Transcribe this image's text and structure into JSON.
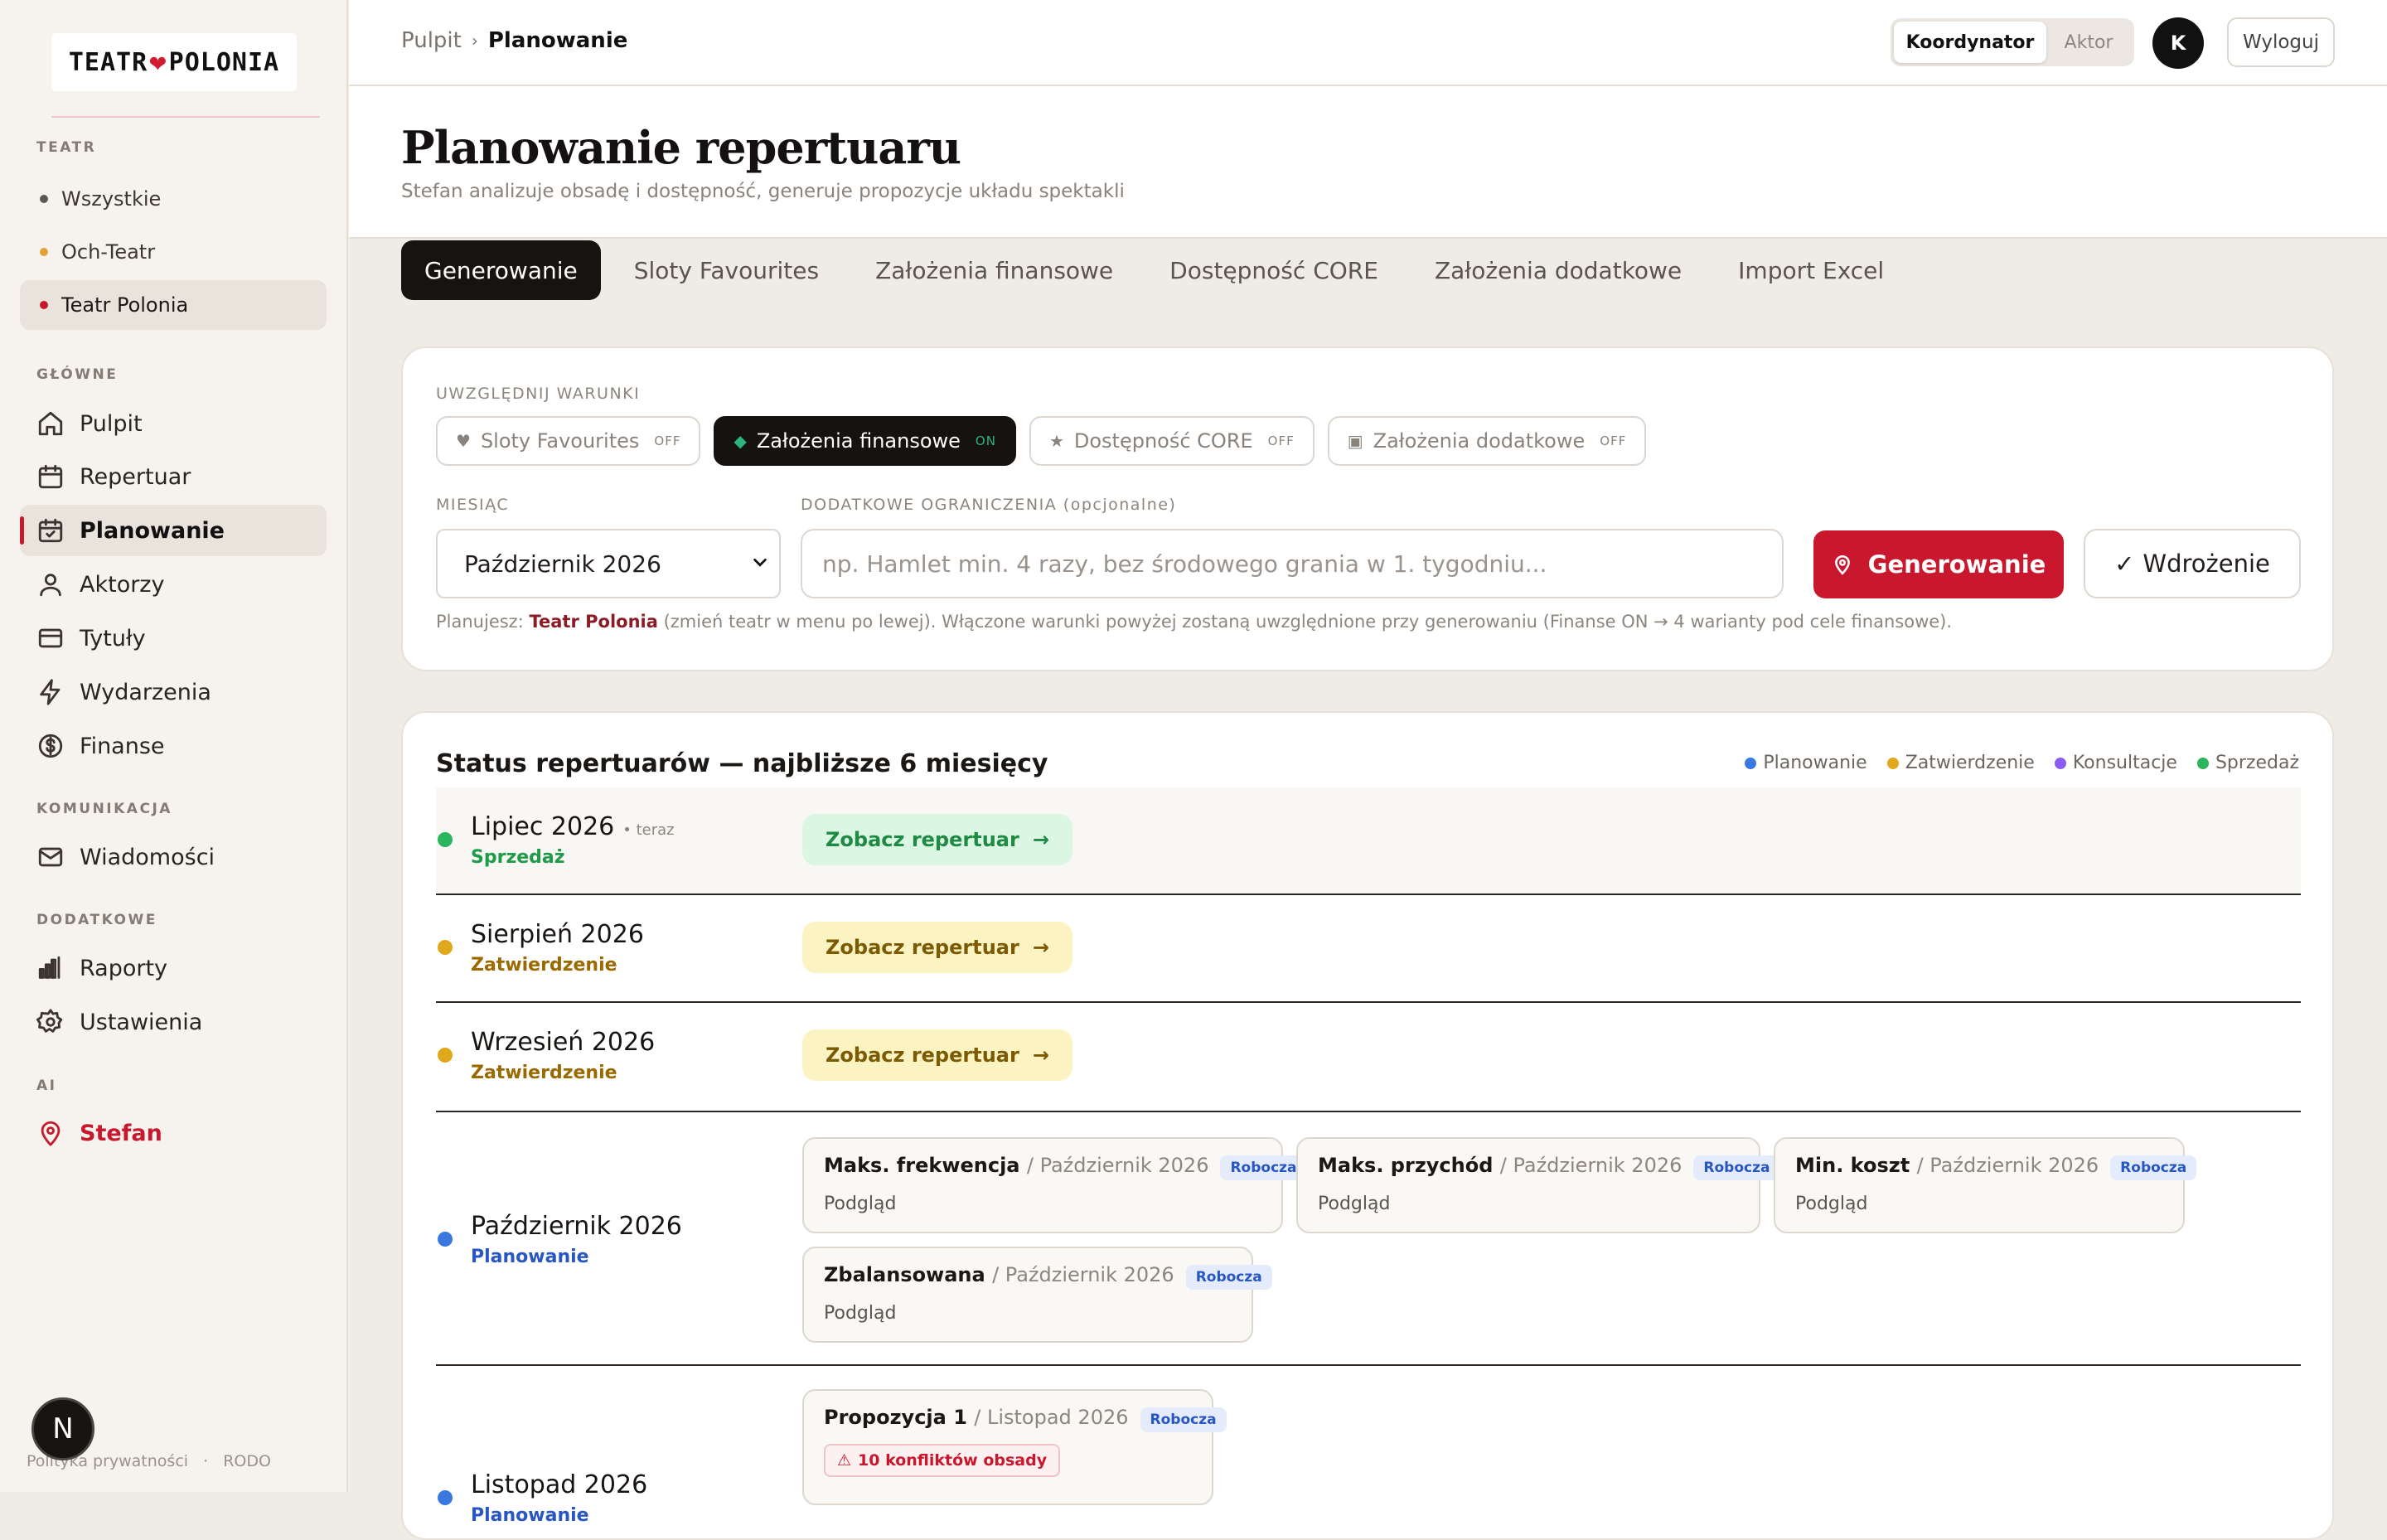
{
  "sidebar": {
    "logo_left": "TEATR",
    "logo_heart": "❤",
    "logo_right": "POLONIA",
    "sec_theatre": "TEATR",
    "theatres": [
      {
        "label": "Wszystkie",
        "color": "#5c5550"
      },
      {
        "label": "Och-Teatr",
        "color": "#e2a23a"
      },
      {
        "label": "Teatr Polonia",
        "color": "#c8182d"
      }
    ],
    "sec_main": "GŁÓWNE",
    "nav_main": [
      "Pulpit",
      "Repertuar",
      "Planowanie",
      "Aktorzy",
      "Tytuły",
      "Wydarzenia",
      "Finanse"
    ],
    "sec_comm": "KOMUNIKACJA",
    "nav_comm": [
      "Wiadomości"
    ],
    "sec_extra": "DODATKOWE",
    "nav_extra": [
      "Raporty",
      "Ustawienia"
    ],
    "sec_ai": "AI",
    "nav_ai": "Stefan",
    "footer_privacy": "Polityka prywatności",
    "footer_dot": "·",
    "footer_rodo": "RODO",
    "badge": "N"
  },
  "topbar": {
    "breadcrumb_root": "Pulpit",
    "breadcrumb_sep": "›",
    "breadcrumb_current": "Planowanie",
    "role_active": "Koordynator",
    "role_inactive": "Aktor",
    "avatar": "K",
    "logout": "Wyloguj"
  },
  "page": {
    "title": "Planowanie repertuaru",
    "subtitle": "Stefan analizuje obsadę i dostępność, generuje propozycje układu spektakli"
  },
  "tabs": [
    "Generowanie",
    "Sloty Favourites",
    "Założenia finansowe",
    "Dostępność CORE",
    "Założenia dodatkowe",
    "Import Excel"
  ],
  "generator": {
    "conditions_label": "UWZGLĘDNIJ WARUNKI",
    "chips": [
      {
        "icon": "♥",
        "label": "Sloty Favourites",
        "state": "OFF"
      },
      {
        "icon": "◆",
        "label": "Założenia finansowe",
        "state": "ON"
      },
      {
        "icon": "★",
        "label": "Dostępność CORE",
        "state": "OFF"
      },
      {
        "icon": "▣",
        "label": "Założenia dodatkowe",
        "state": "OFF"
      }
    ],
    "month_label": "MIESIĄC",
    "month_value": "Październik 2026",
    "constraints_label": "DODATKOWE OGRANICZENIA (opcjonalne)",
    "constraints_placeholder": "np. Hamlet min. 4 razy, bez środowego grania w 1. tygodniu...",
    "generate_button": "Generowanie",
    "deploy_check": "✓",
    "deploy_button": "Wdrożenie",
    "hint_prefix": "Planujesz:",
    "hint_theatre": "Teatr Polonia",
    "hint_suffix": "(zmień teatr w menu po lewej). Włączone warunki powyżej zostaną uwzględnione przy generowaniu (Finanse ON → 4 warianty pod cele finansowe)."
  },
  "status": {
    "title": "Status repertuarów — najbliższe 6 miesięcy",
    "legend": [
      {
        "label": "Planowanie",
        "color": "#3a78e0"
      },
      {
        "label": "Zatwierdzenie",
        "color": "#e0a81a"
      },
      {
        "label": "Konsultacje",
        "color": "#8b5cf0"
      },
      {
        "label": "Sprzedaż",
        "color": "#2bb55c"
      }
    ],
    "now_label": "• teraz",
    "view_label": "Zobacz repertuar",
    "arrow": "→",
    "months": [
      {
        "month": "Lipiec 2026",
        "status": "Sprzedaż"
      },
      {
        "month": "Sierpień 2026",
        "status": "Zatwierdzenie"
      },
      {
        "month": "Wrzesień 2026",
        "status": "Zatwierdzenie"
      },
      {
        "month": "Październik 2026",
        "status": "Planowanie"
      },
      {
        "month": "Listopad 2026",
        "status": "Planowanie"
      }
    ],
    "october_variants": [
      {
        "name": "Maks. frekwencja",
        "month": "/ Październik 2026",
        "badge": "Robocza",
        "preview": "Podgląd"
      },
      {
        "name": "Maks. przychód",
        "month": "/ Październik 2026",
        "badge": "Robocza",
        "preview": "Podgląd"
      },
      {
        "name": "Min. koszt",
        "month": "/ Październik 2026",
        "badge": "Robocza",
        "preview": "Podgląd"
      },
      {
        "name": "Zbalansowana",
        "month": "/ Październik 2026",
        "badge": "Robocza",
        "preview": "Podgląd"
      }
    ],
    "november_variant": {
      "name": "Propozycja 1",
      "month": "/ Listopad 2026",
      "badge": "Robocza",
      "conflicts_icon": "⚠",
      "conflicts": "10 konfliktów obsady"
    }
  }
}
